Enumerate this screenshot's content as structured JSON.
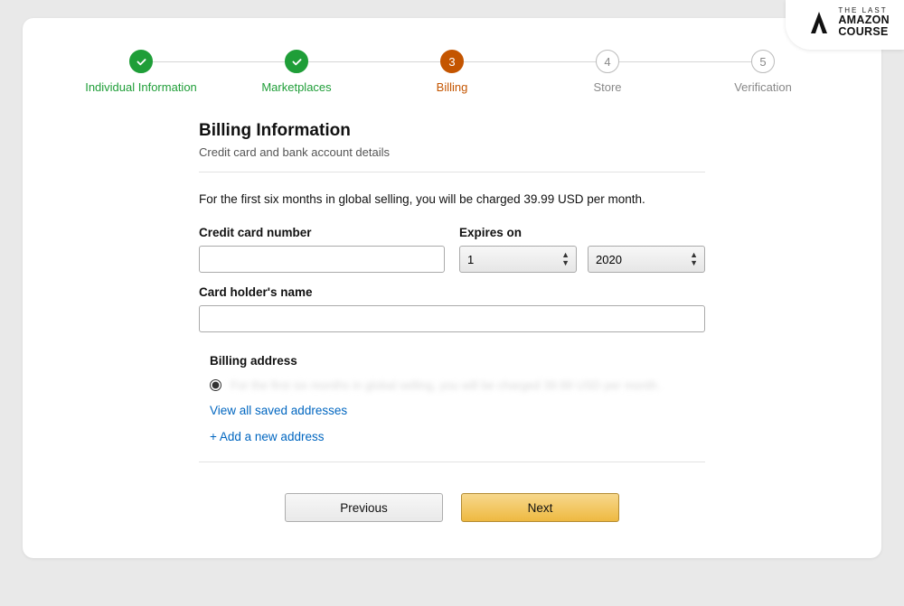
{
  "badge": {
    "line1": "THE LAST",
    "line2": "AMAZON",
    "line3": "COURSE"
  },
  "steps": [
    {
      "label": "Individual Information",
      "state": "done"
    },
    {
      "label": "Marketplaces",
      "state": "done"
    },
    {
      "label": "Billing",
      "state": "active",
      "number": "3"
    },
    {
      "label": "Store",
      "state": "pending",
      "number": "4"
    },
    {
      "label": "Verification",
      "state": "pending",
      "number": "5"
    }
  ],
  "header": {
    "title": "Billing Information",
    "subtitle": "Credit card and bank account details"
  },
  "notice": "For the first six months in global selling, you will be charged 39.99 USD per month.",
  "form": {
    "card_number_label": "Credit card number",
    "card_number_value": "",
    "expires_label": "Expires on",
    "exp_month": "1",
    "exp_year": "2020",
    "holder_label": "Card holder's name",
    "holder_value": ""
  },
  "billing": {
    "heading": "Billing address",
    "selected_blur": "For the first six months in global selling, you will be charged 39.99 USD per month.",
    "view_all": "View all saved addresses",
    "add_new": "+ Add a new address"
  },
  "buttons": {
    "prev": "Previous",
    "next": "Next"
  }
}
